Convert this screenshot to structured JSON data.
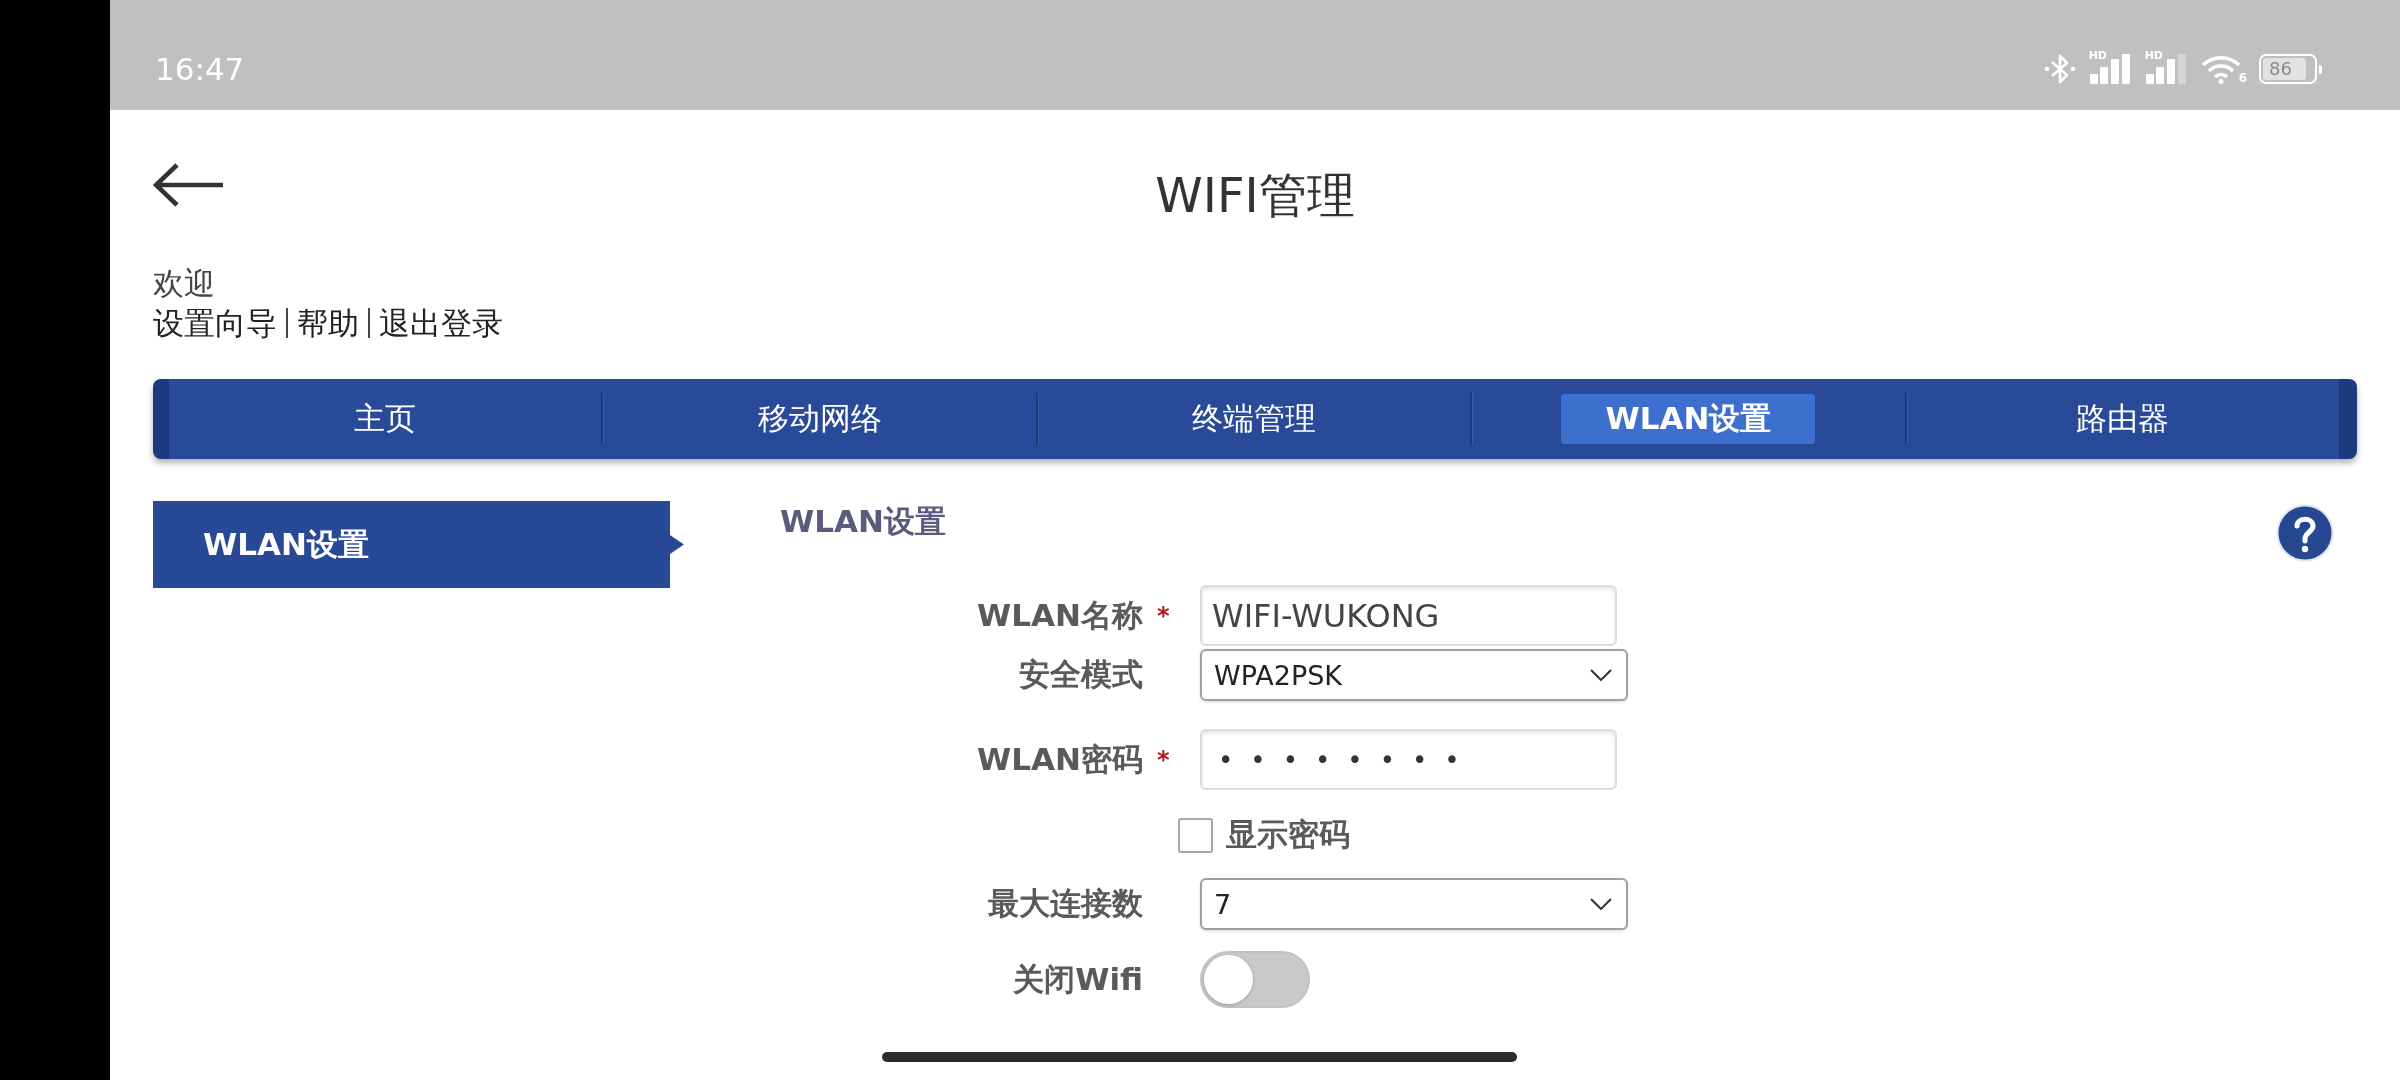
{
  "status_bar": {
    "time": "16:47",
    "signals": [
      {
        "label": "HD"
      },
      {
        "label": "HD"
      }
    ],
    "wifi_label": "6",
    "battery": "86"
  },
  "header": {
    "title": "WIFI管理"
  },
  "welcome": {
    "greeting": "欢迎",
    "links": [
      "设置向导",
      "帮助",
      "退出登录"
    ]
  },
  "nav": {
    "tabs": [
      {
        "label": "主页",
        "selected": false
      },
      {
        "label": "移动网络",
        "selected": false
      },
      {
        "label": "终端管理",
        "selected": false
      },
      {
        "label": "WLAN设置",
        "selected": true
      },
      {
        "label": "路由器",
        "selected": false
      }
    ]
  },
  "sidebar": {
    "items": [
      {
        "label": "WLAN设置",
        "selected": true
      }
    ]
  },
  "section": {
    "title": "WLAN设置"
  },
  "form": {
    "fields": [
      {
        "kind": "text",
        "label": "WLAN名称",
        "required_mark": "*",
        "value": "WIFI-WUKONG"
      },
      {
        "kind": "select",
        "label": "安全模式",
        "value": "WPA2PSK"
      },
      {
        "kind": "password",
        "label": "WLAN密码",
        "required_mark": "*",
        "value": "••••••••"
      },
      {
        "kind": "checkbox",
        "label": "显示密码",
        "checked": false
      },
      {
        "kind": "select",
        "label": "最大连接数",
        "value": "7"
      },
      {
        "kind": "toggle",
        "label": "关闭Wifi",
        "on": false
      }
    ]
  }
}
